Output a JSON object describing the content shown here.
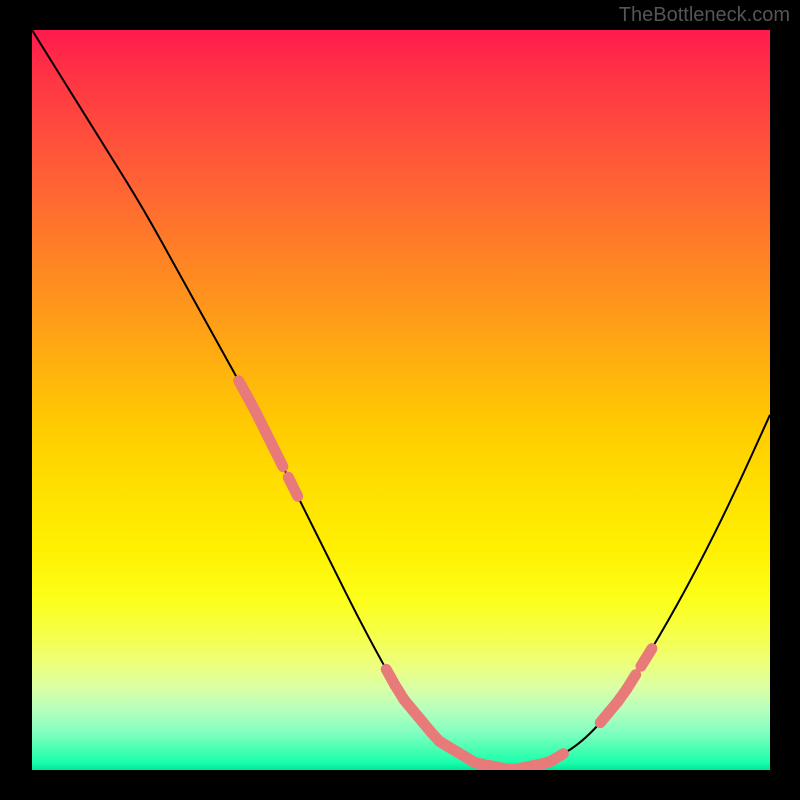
{
  "watermark": "TheBottleneck.com",
  "chart_data": {
    "type": "line",
    "title": "",
    "xlabel": "",
    "ylabel": "",
    "xlim": [
      0,
      100
    ],
    "ylim": [
      0,
      100
    ],
    "grid": false,
    "series": [
      {
        "name": "curve",
        "x": [
          0,
          5,
          10,
          15,
          20,
          25,
          30,
          35,
          40,
          45,
          50,
          55,
          60,
          65,
          70,
          75,
          80,
          85,
          90,
          95,
          100
        ],
        "values": [
          100,
          92,
          84,
          76,
          67,
          58,
          49,
          39,
          29,
          19,
          10,
          4,
          1,
          0,
          1,
          4,
          10,
          18,
          27,
          37,
          48
        ]
      }
    ],
    "markers": {
      "name": "highlight-segments",
      "color": "#e97a7a",
      "segments": [
        {
          "x_range": [
            28,
            36
          ],
          "note": "left descending band"
        },
        {
          "x_range": [
            48,
            72
          ],
          "note": "bottom trough band"
        },
        {
          "x_range": [
            77,
            84
          ],
          "note": "right ascending band"
        }
      ]
    },
    "background_gradient": {
      "type": "vertical",
      "stops": [
        {
          "pos": 0,
          "color": "#ff1a4d"
        },
        {
          "pos": 50,
          "color": "#ffcc00"
        },
        {
          "pos": 85,
          "color": "#f5ff4d"
        },
        {
          "pos": 100,
          "color": "#00e699"
        }
      ]
    }
  }
}
